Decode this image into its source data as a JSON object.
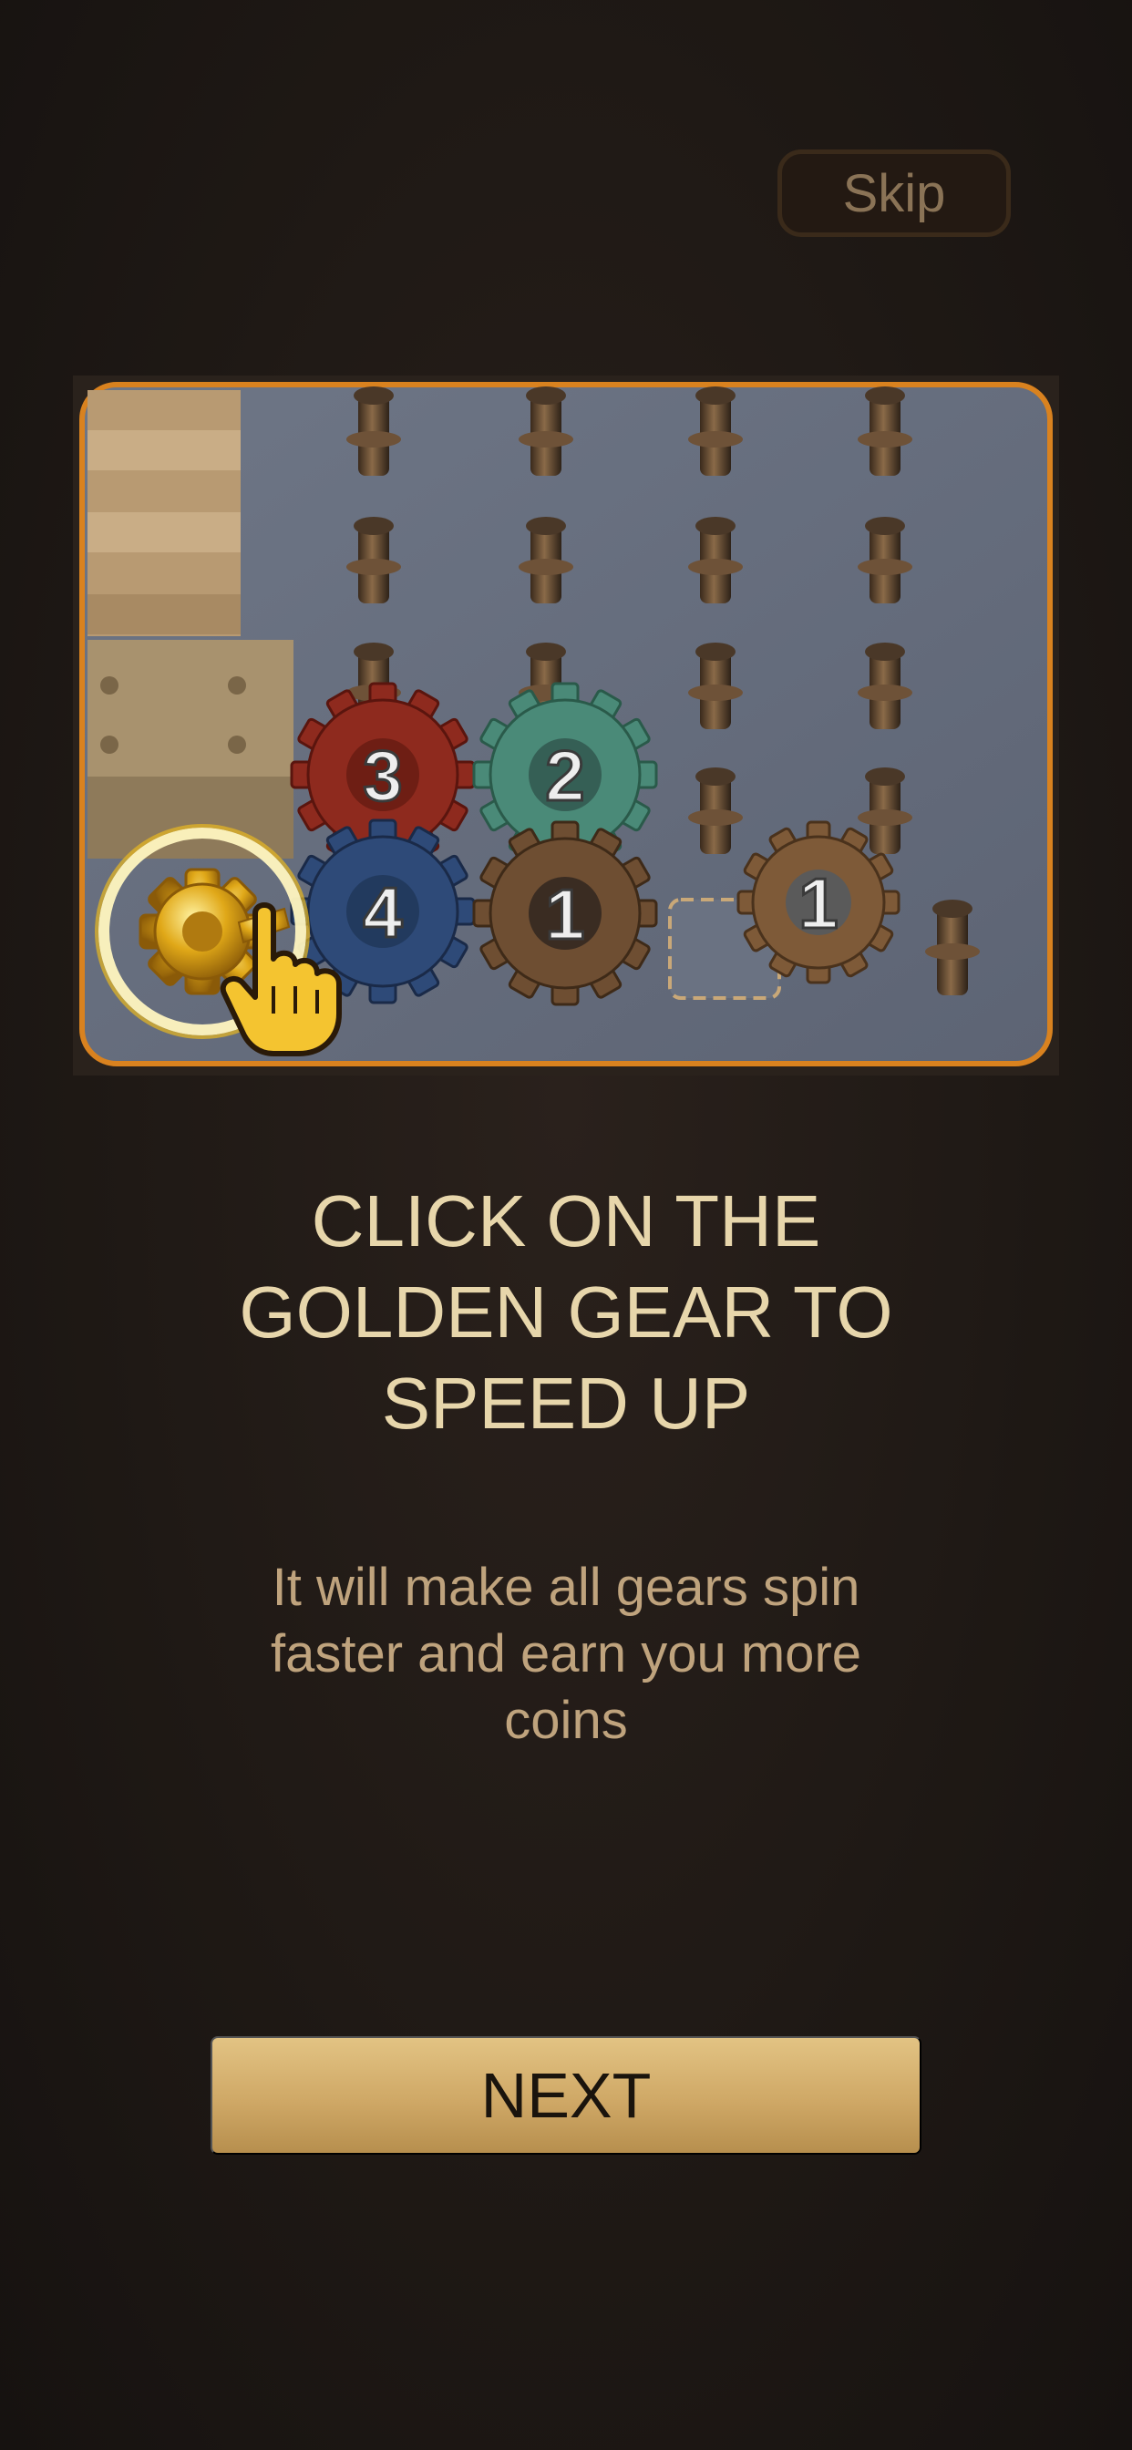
{
  "skip": {
    "label": "Skip"
  },
  "tutorial": {
    "headline": "CLICK ON THE\nGOLDEN GEAR TO\nSPEED UP",
    "description": "It will make all gears spin\nfaster and earn you more\ncoins"
  },
  "preview": {
    "gears": [
      {
        "number": "3",
        "color": "red"
      },
      {
        "number": "2",
        "color": "teal"
      },
      {
        "number": "4",
        "color": "blue"
      },
      {
        "number": "1",
        "color": "bronze"
      },
      {
        "number": "1",
        "color": "bronze"
      }
    ],
    "icons": [
      "golden-gear-icon",
      "hand-pointer-icon"
    ]
  },
  "next": {
    "label": "NEXT"
  },
  "colors": {
    "background": "#1c1613",
    "accent_gold": "#d4ac6a",
    "frame_orange": "#d9821f",
    "headline_text": "#e7d6ab"
  }
}
